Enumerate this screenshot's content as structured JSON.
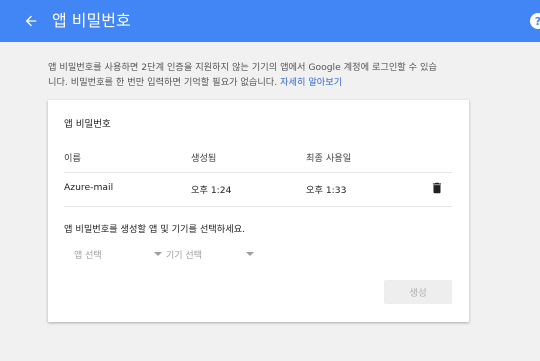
{
  "app_bar": {
    "title": "앱 비밀번호",
    "back_icon": "arrow-left-icon",
    "help_icon": "help-icon",
    "help_glyph": "?"
  },
  "description": {
    "line1": "앱 비밀번호를 사용하면 2단계 인증을 지원하지 않는 기기의 앱에서 Google 계정에 로그인할 수 있습",
    "line2": "니다. 비밀번호를 한 번만 입력하면 기억할 필요가 없습니다.",
    "link": "자세히 알아보기"
  },
  "card": {
    "title": "앱 비밀번호",
    "columns": [
      "이름",
      "생성됨",
      "최종 사용일"
    ],
    "rows": [
      {
        "name": "Azure-mail",
        "created": "오후 1:24",
        "last_used": "오후 1:33",
        "action_icon": "trash-icon"
      }
    ],
    "prompt": "앱 비밀번호를 생성할 앱 및 기기를 선택하세요.",
    "select_app": "앱 선택",
    "select_device": "기기 선택",
    "generate_label": "생성"
  },
  "colors": {
    "app_bar": "#4285f4",
    "link": "#3367d6",
    "background": "#f1f1f1"
  }
}
